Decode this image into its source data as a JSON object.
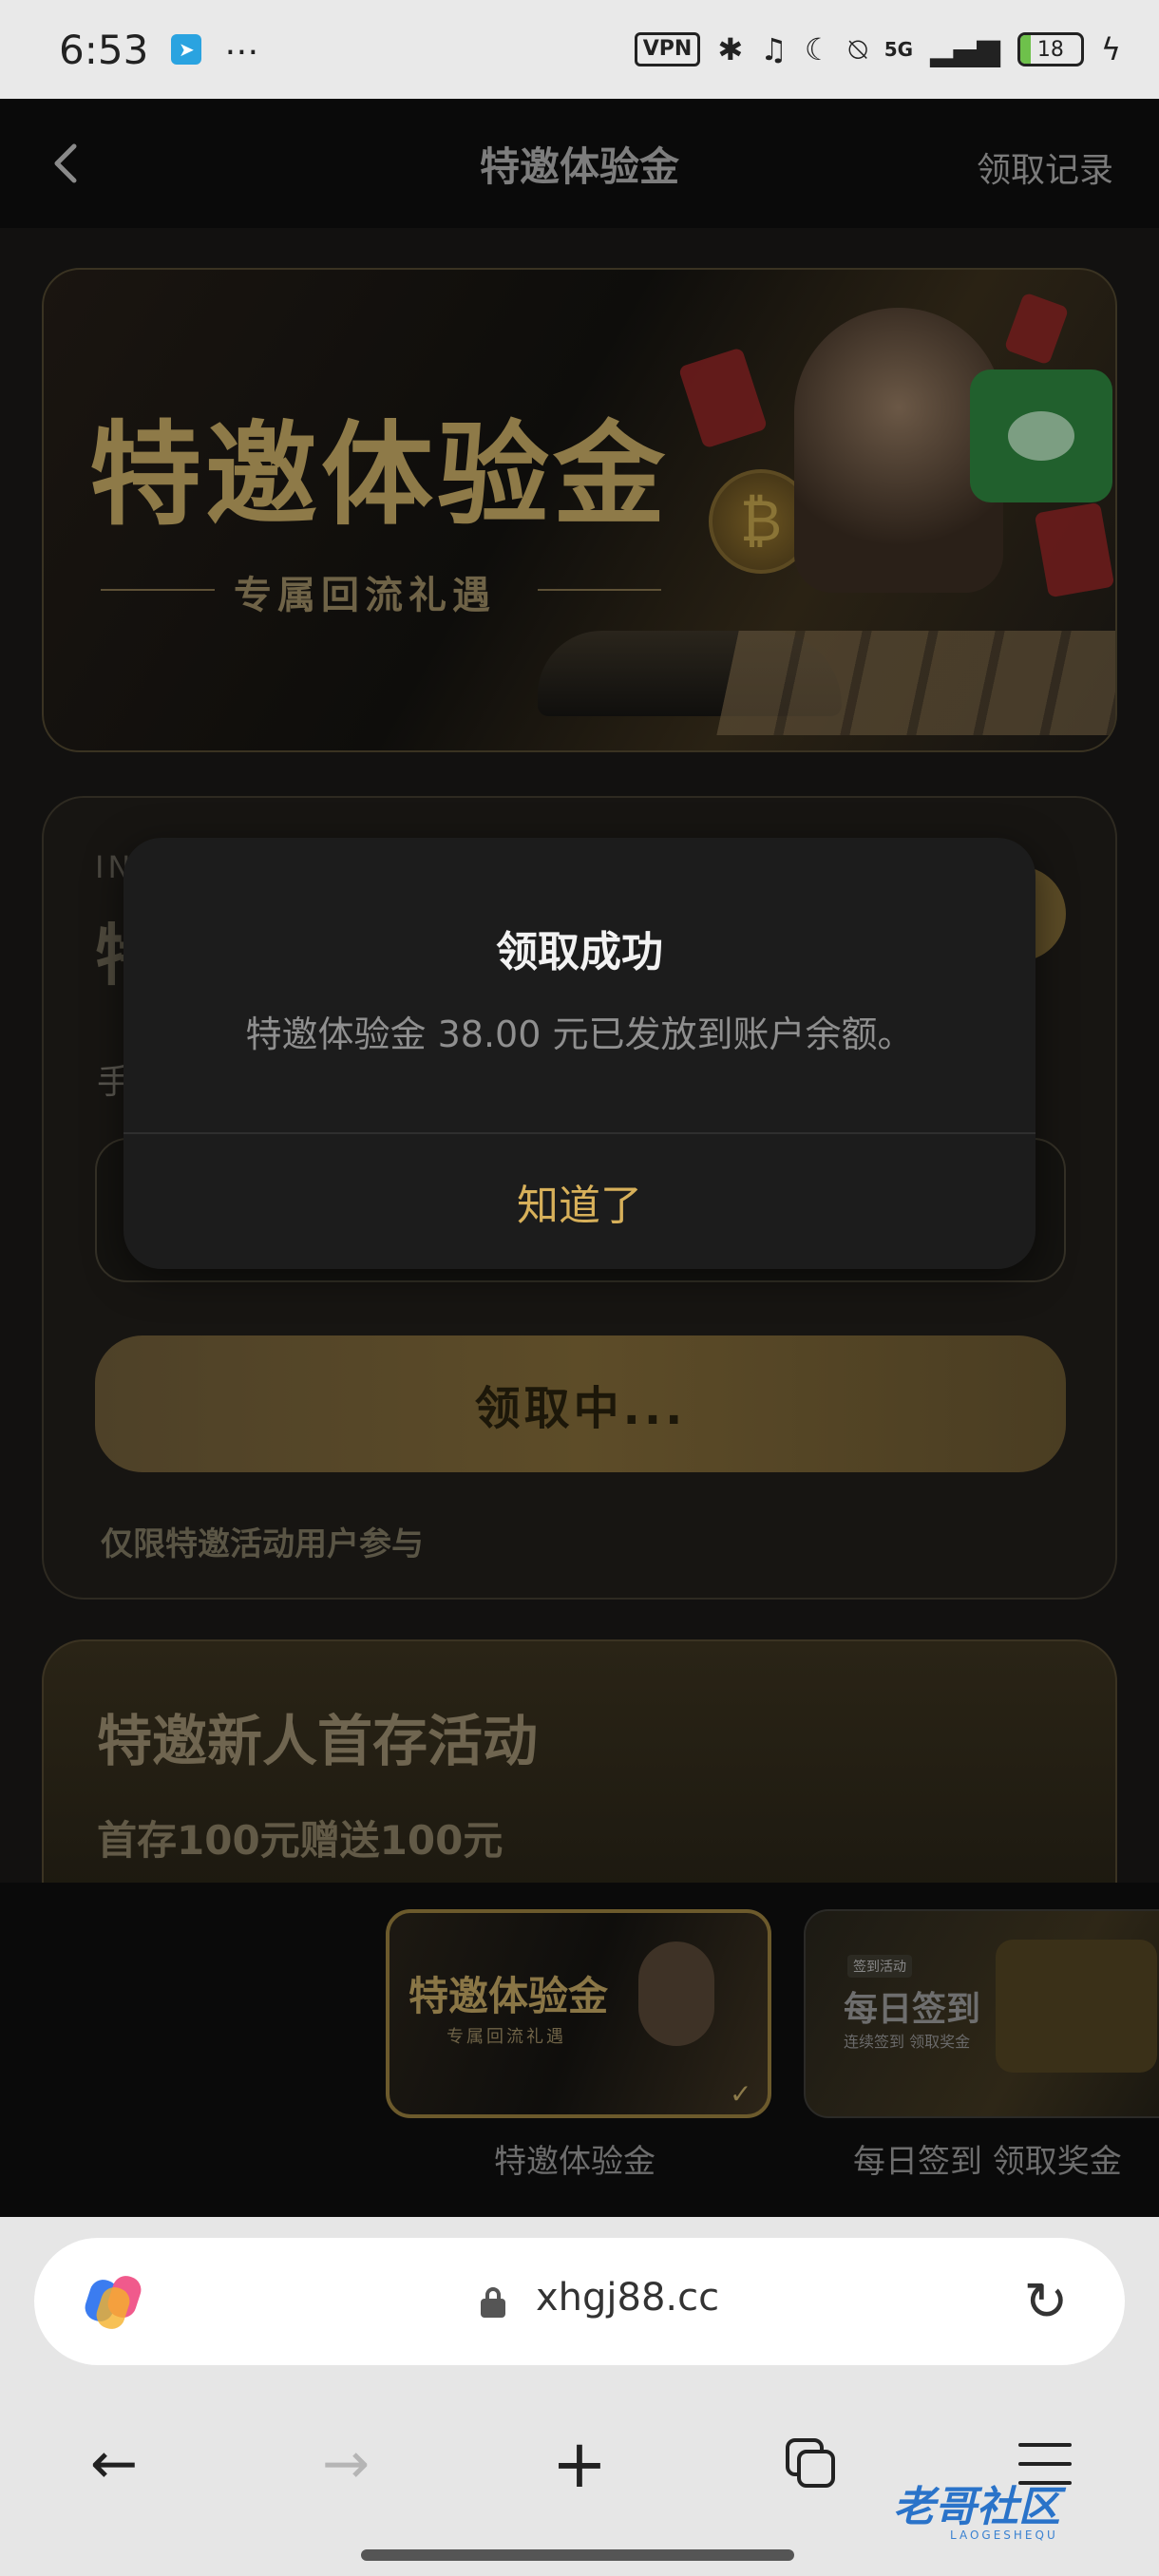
{
  "status_bar": {
    "time": "6:53",
    "vpn": "VPN",
    "network": "5G",
    "battery": "18",
    "battery_level": 0.18
  },
  "header": {
    "back_icon": "chevron-left-icon",
    "title": "特邀体验金",
    "records": "领取记录"
  },
  "banner": {
    "title": "特邀体验金",
    "subtitle": "专属回流礼遇"
  },
  "card": {
    "eyebrow": "IN",
    "heading": "特",
    "label": "手",
    "claim_button": "领取中...",
    "note": "仅限特邀活动用户参与"
  },
  "promo": {
    "title": "特邀新人首存活动",
    "subtitle": "首存100元赠送100元"
  },
  "carousel": {
    "items": [
      {
        "title": "特邀体验金",
        "subtitle": "专属回流礼遇",
        "label": "特邀体验金",
        "selected": true
      },
      {
        "badge": "签到活动",
        "title": "每日签到",
        "subtitle": "连续签到 领取奖金",
        "label": "每日签到 领取奖金",
        "selected": false
      }
    ]
  },
  "modal": {
    "title": "领取成功",
    "message": "特邀体验金 38.00 元已发放到账户余额。",
    "ok": "知道了"
  },
  "browser": {
    "url": "xhgj88.cc"
  },
  "watermark": {
    "text": "老哥社区",
    "sub": "LAOGESHEQU"
  },
  "colors": {
    "accent_gold": "#d7b05a",
    "modal_bg": "#1c1c1c",
    "browser_bg": "#e6e6e6"
  }
}
